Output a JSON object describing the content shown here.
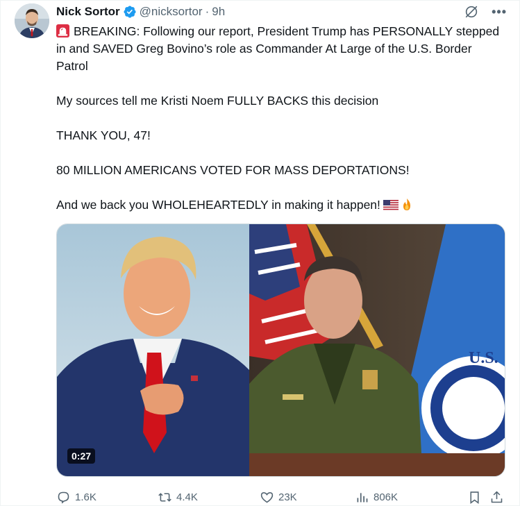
{
  "author": {
    "display_name": "Nick Sortor",
    "handle": "@nicksortor",
    "separator": "·",
    "time": "9h"
  },
  "tweet": {
    "line1": "BREAKING: Following our report, President Trump has PERSONALLY stepped in and SAVED Greg Bovino’s role as Commander At Large of the U.S. Border Patrol",
    "line2": "My sources tell me Kristi Noem FULLY BACKS this decision",
    "line3": "THANK YOU, 47!",
    "line4": "80 MILLION AMERICANS VOTED FOR MASS DEPORTATIONS!",
    "line5": "And we back you WHOLEHEARTEDLY in making it happen!"
  },
  "media": {
    "duration": "0:27",
    "seal_text": "U.S."
  },
  "actions": {
    "replies": "1.6K",
    "reposts": "4.4K",
    "likes": "23K",
    "views": "806K"
  },
  "icons": {
    "verified": "verified-badge-icon",
    "grok": "grok-icon",
    "more": "more-icon",
    "reply": "reply-icon",
    "repost": "repost-icon",
    "like": "heart-icon",
    "views": "views-chart-icon",
    "bookmark": "bookmark-icon",
    "share": "share-icon"
  },
  "colors": {
    "verified_blue": "#1d9bf0",
    "text": "#0f1419",
    "muted": "#536471"
  }
}
